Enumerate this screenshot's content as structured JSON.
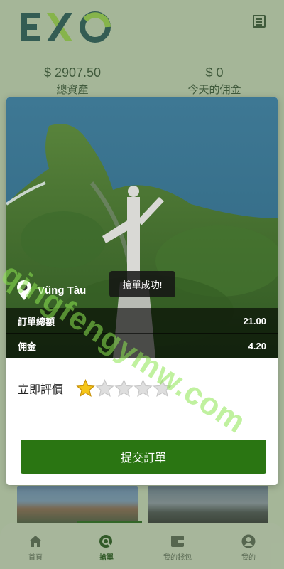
{
  "app": {
    "logo_text": "EXO"
  },
  "stats": {
    "total_assets_value": "$ 2907.50",
    "total_assets_label": "總資產",
    "today_commission_value": "$ 0",
    "today_commission_label": "今天的佣金"
  },
  "modal": {
    "location": "Vũng Tàu",
    "toast": "搶單成功!",
    "order_total_label": "訂單總額",
    "order_total_value": "21.00",
    "commission_label": "佣金",
    "commission_value": "4.20",
    "rate_label": "立即評價",
    "rating": 1,
    "max_rating": 5,
    "submit_label": "提交訂單"
  },
  "watermark": "qingfengymw.com",
  "nav": {
    "items": [
      {
        "label": "首頁",
        "icon": "home-icon"
      },
      {
        "label": "搶單",
        "icon": "order-search-icon",
        "active": true
      },
      {
        "label": "我的錢包",
        "icon": "wallet-icon"
      },
      {
        "label": "我的",
        "icon": "profile-icon"
      }
    ]
  },
  "colors": {
    "accent": "#2a7512",
    "brand_dark": "#1c4d1a",
    "brand_green": "#5cad28"
  }
}
